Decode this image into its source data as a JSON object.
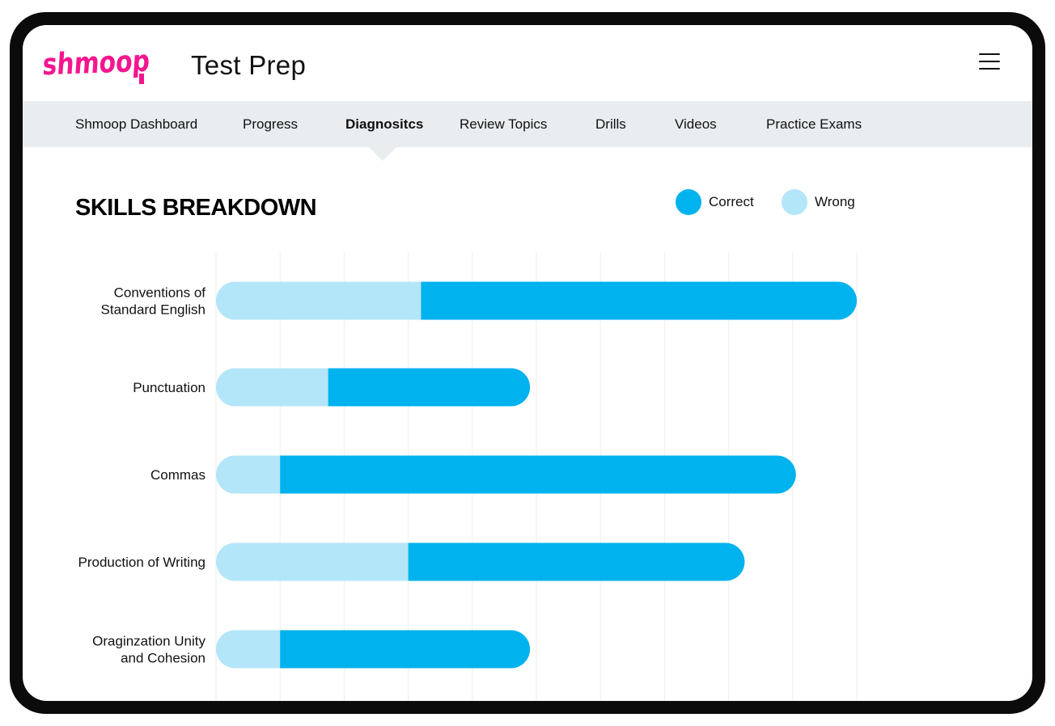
{
  "header": {
    "logo_text": "shmoop",
    "app_title": "Test Prep",
    "menu_icon": "hamburger-menu-icon"
  },
  "nav": {
    "items": [
      {
        "label": "Shmoop Dashboard",
        "active": false
      },
      {
        "label": "Progress",
        "active": false
      },
      {
        "label": "Diagnositcs",
        "active": true
      },
      {
        "label": "Review Topics",
        "active": false
      },
      {
        "label": "Drills",
        "active": false
      },
      {
        "label": "Videos",
        "active": false
      },
      {
        "label": "Practice Exams",
        "active": false
      }
    ]
  },
  "section": {
    "title": "SKILLS BREAKDOWN"
  },
  "legend": {
    "correct_label": "Correct",
    "wrong_label": "Wrong"
  },
  "colors": {
    "brand": "#f5168f",
    "correct": "#00b2ed",
    "wrong": "#b3e6f8",
    "nav_bg": "#e9edf0",
    "device_frame": "#0b0b0b"
  },
  "chart_data": {
    "type": "bar",
    "orientation": "horizontal",
    "stacked": true,
    "categories": [
      [
        "Conventions of",
        "Standard English"
      ],
      [
        "Punctuation"
      ],
      [
        "Commas"
      ],
      [
        "Production of Writing"
      ],
      [
        "Oraginzation Unity",
        "and Cohesion"
      ]
    ],
    "series": [
      {
        "name": "Wrong",
        "values": [
          3.2,
          1.75,
          1.0,
          3.0,
          1.0
        ]
      },
      {
        "name": "Correct",
        "values": [
          6.8,
          3.15,
          8.05,
          5.25,
          3.9
        ]
      }
    ],
    "xlim": [
      0,
      10
    ],
    "grid": true,
    "legend_position": "top-right"
  }
}
